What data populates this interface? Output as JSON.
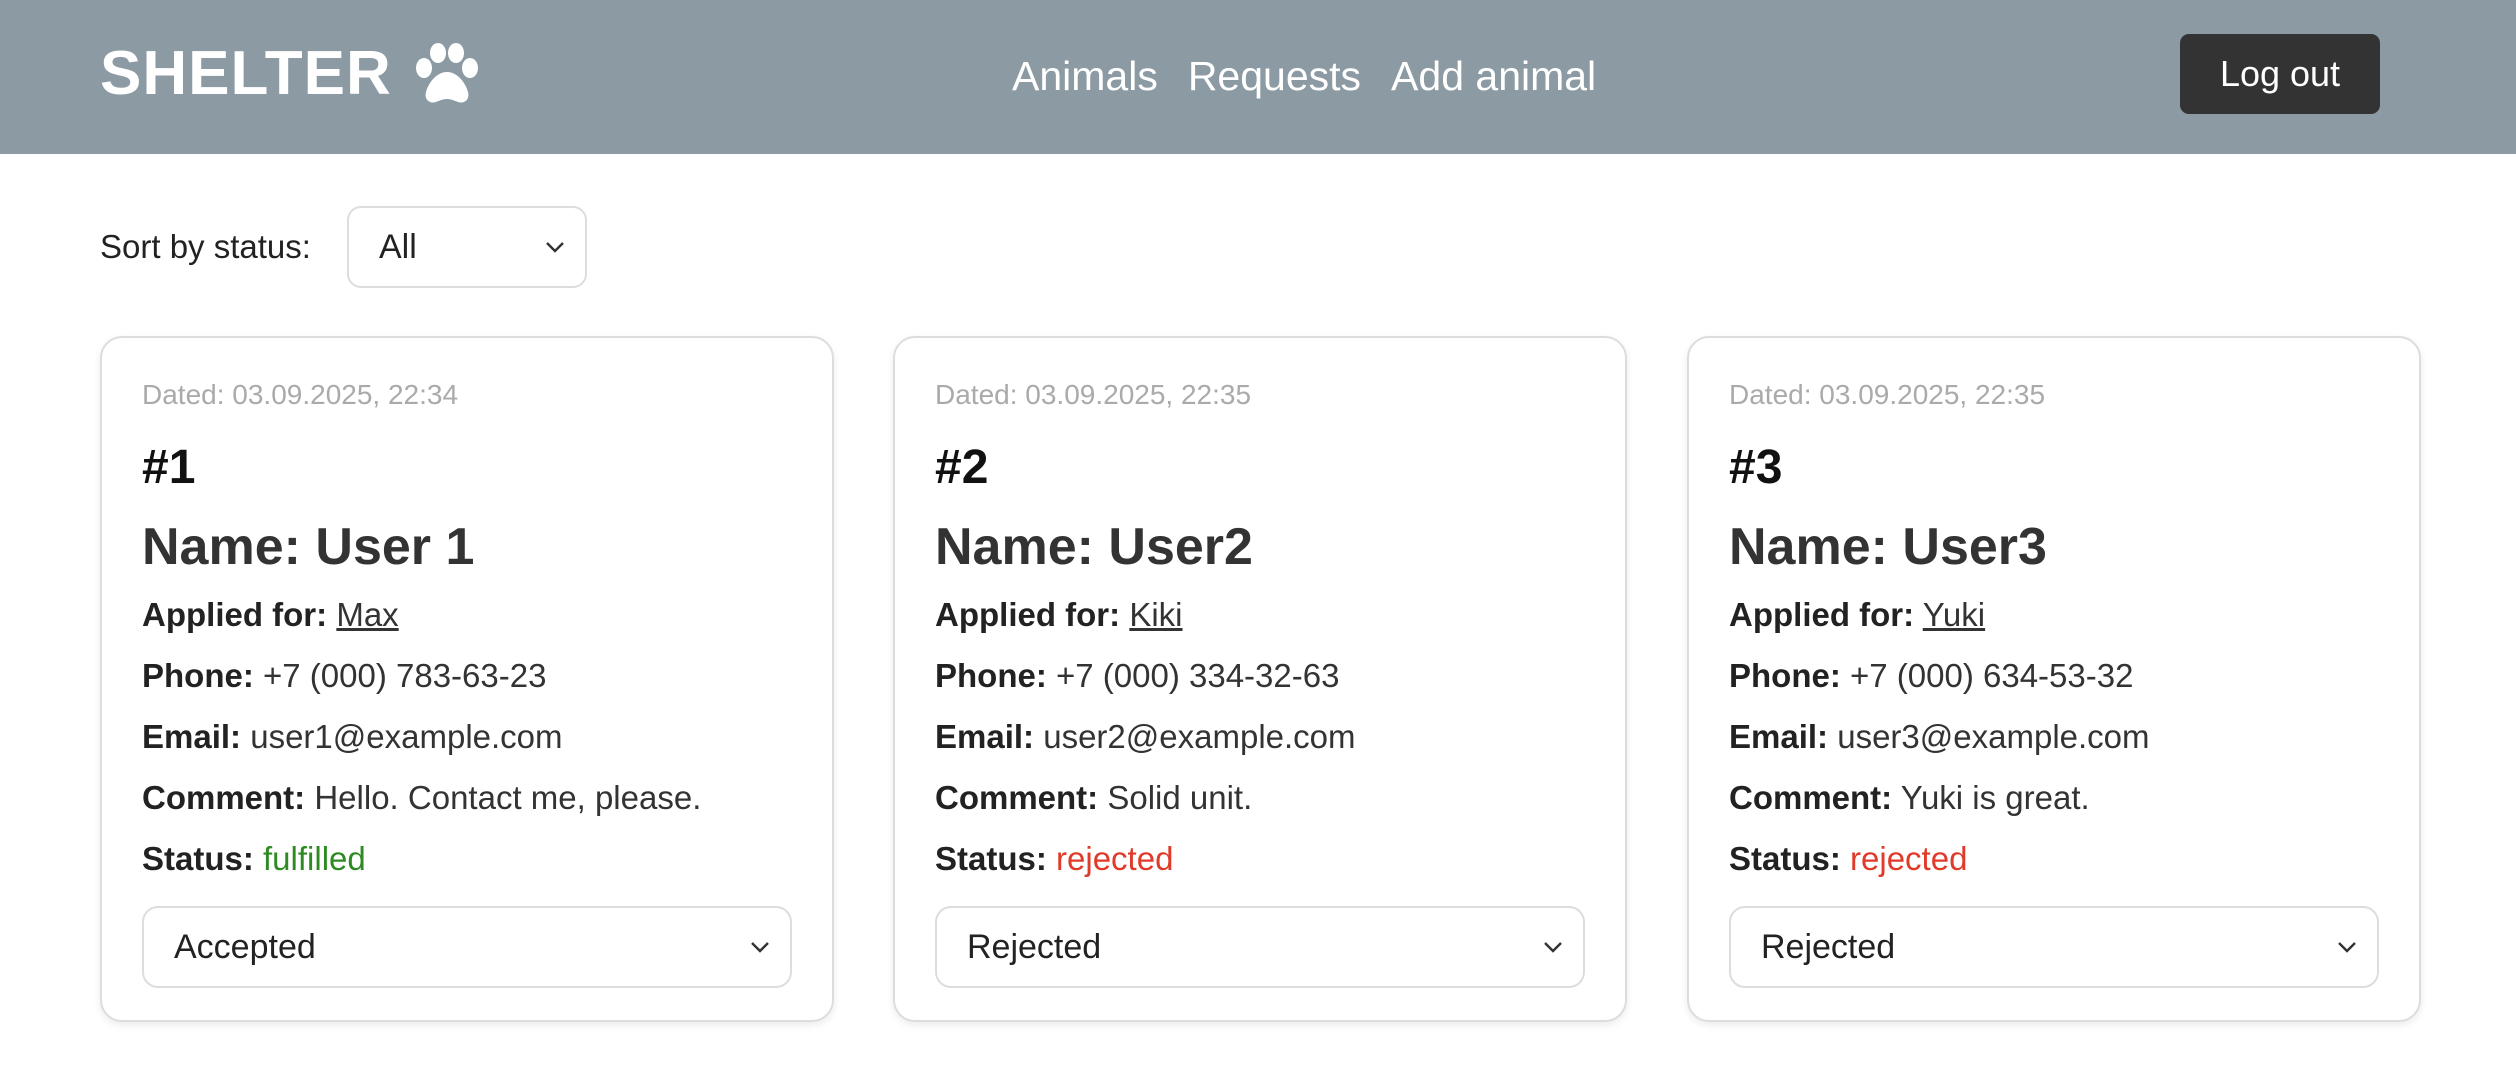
{
  "header": {
    "logo_text": "SHELTER",
    "nav": [
      "Animals",
      "Requests",
      "Add animal"
    ],
    "logout_label": "Log out"
  },
  "sort": {
    "label": "Sort by status:",
    "value": "All"
  },
  "requests": [
    {
      "dated": "Dated: 03.09.2025, 22:34",
      "number": "#1",
      "name": "Name: User 1",
      "applied_label": "Applied for:",
      "applied_for": "Max",
      "phone_label": "Phone:",
      "phone": "+7 (000) 783-63-23",
      "email_label": "Email:",
      "email": "user1@example.com",
      "comment_label": "Comment:",
      "comment": "Hello. Contact me, please.",
      "status_label": "Status:",
      "status": "fulfilled",
      "select_value": "Accepted"
    },
    {
      "dated": "Dated: 03.09.2025, 22:35",
      "number": "#2",
      "name": "Name: User2",
      "applied_label": "Applied for:",
      "applied_for": "Kiki",
      "phone_label": "Phone:",
      "phone": "+7 (000) 334-32-63",
      "email_label": "Email:",
      "email": "user2@example.com",
      "comment_label": "Comment:",
      "comment": "Solid unit.",
      "status_label": "Status:",
      "status": "rejected",
      "select_value": "Rejected"
    },
    {
      "dated": "Dated: 03.09.2025, 22:35",
      "number": "#3",
      "name": "Name: User3",
      "applied_label": "Applied for:",
      "applied_for": "Yuki",
      "phone_label": "Phone:",
      "phone": "+7 (000) 634-53-32",
      "email_label": "Email:",
      "email": "user3@example.com",
      "comment_label": "Comment:",
      "comment": "Yuki is great.",
      "status_label": "Status:",
      "status": "rejected",
      "select_value": "Rejected"
    }
  ],
  "colors": {
    "header_bg": "#8c9aa3",
    "status_fulfilled": "#2e8a23",
    "status_rejected": "#e03a2a",
    "button_dark": "#333333"
  },
  "icons": {
    "logo": "paw-icon",
    "select": "chevron-down-icon"
  }
}
